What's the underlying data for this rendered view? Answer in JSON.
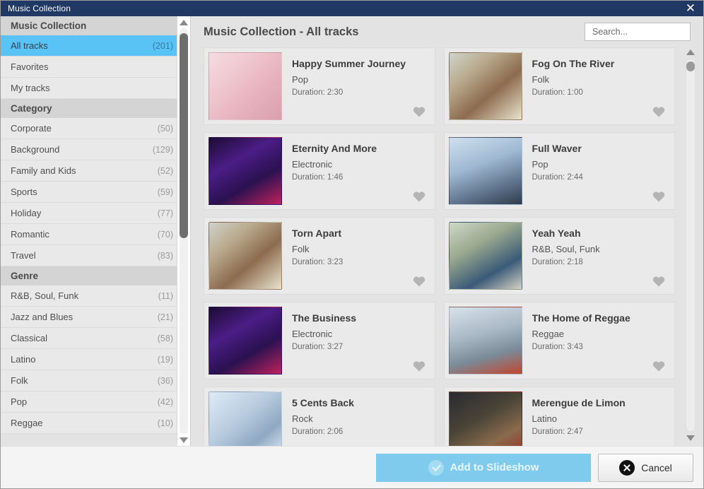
{
  "window": {
    "title": "Music Collection",
    "close_label": "✕"
  },
  "sidebar": {
    "sections": [
      {
        "header": "Music Collection",
        "items": [
          {
            "label": "All tracks",
            "count": "(201)",
            "selected": true
          },
          {
            "label": "Favorites",
            "count": "",
            "selected": false
          },
          {
            "label": "My tracks",
            "count": "",
            "selected": false
          }
        ]
      },
      {
        "header": "Category",
        "items": [
          {
            "label": "Corporate",
            "count": "(50)",
            "selected": false
          },
          {
            "label": "Background",
            "count": "(129)",
            "selected": false
          },
          {
            "label": "Family and Kids",
            "count": "(52)",
            "selected": false
          },
          {
            "label": "Sports",
            "count": "(59)",
            "selected": false
          },
          {
            "label": "Holiday",
            "count": "(77)",
            "selected": false
          },
          {
            "label": "Romantic",
            "count": "(70)",
            "selected": false
          },
          {
            "label": "Travel",
            "count": "(83)",
            "selected": false
          }
        ]
      },
      {
        "header": "Genre",
        "items": [
          {
            "label": "R&B, Soul, Funk",
            "count": "(11)",
            "selected": false
          },
          {
            "label": "Jazz and Blues",
            "count": "(21)",
            "selected": false
          },
          {
            "label": "Classical",
            "count": "(58)",
            "selected": false
          },
          {
            "label": "Latino",
            "count": "(19)",
            "selected": false
          },
          {
            "label": "Folk",
            "count": "(36)",
            "selected": false
          },
          {
            "label": "Pop",
            "count": "(42)",
            "selected": false
          },
          {
            "label": "Reggae",
            "count": "(10)",
            "selected": false
          }
        ]
      }
    ]
  },
  "main": {
    "title": "Music Collection - All tracks",
    "search": {
      "value": "",
      "placeholder": "Search..."
    },
    "tracks": [
      {
        "title": "Happy Summer Journey",
        "genre": "Pop",
        "duration": "Duration: 2:30",
        "art": "woman-headphones-pink"
      },
      {
        "title": "Fog On The River",
        "genre": "Folk",
        "duration": "Duration: 1:00",
        "art": "guitar-harp-room"
      },
      {
        "title": "Eternity And More",
        "genre": "Electronic",
        "duration": "Duration: 1:46",
        "art": "dj-mixer-purple"
      },
      {
        "title": "Full Waver",
        "genre": "Pop",
        "duration": "Duration: 2:44",
        "art": "skater-street-blue"
      },
      {
        "title": "Torn Apart",
        "genre": "Folk",
        "duration": "Duration: 3:23",
        "art": "guitar-harp-room"
      },
      {
        "title": "Yeah Yeah",
        "genre": "R&B, Soul, Funk",
        "duration": "Duration: 2:18",
        "art": "woman-skateboard"
      },
      {
        "title": "The Business",
        "genre": "Electronic",
        "duration": "Duration: 3:27",
        "art": "dj-mixer-purple"
      },
      {
        "title": "The Home of Reggae",
        "genre": "Reggae",
        "duration": "Duration: 3:43",
        "art": "city-winter-red"
      },
      {
        "title": "5 Cents Back",
        "genre": "Rock",
        "duration": "Duration: 2:06",
        "art": "guitar-ice-blue"
      },
      {
        "title": "Merengue de Limon",
        "genre": "Latino",
        "duration": "Duration: 2:47",
        "art": "dancers-dark-red"
      }
    ]
  },
  "footer": {
    "primary_label": "Add to Slideshow",
    "secondary_label": "Cancel"
  },
  "colors": {
    "titlebar": "#1f3864",
    "selection": "#59c3f5",
    "primary_button": "#7fcbee",
    "panel": "#e3e3e3",
    "card": "#eaeaea"
  }
}
